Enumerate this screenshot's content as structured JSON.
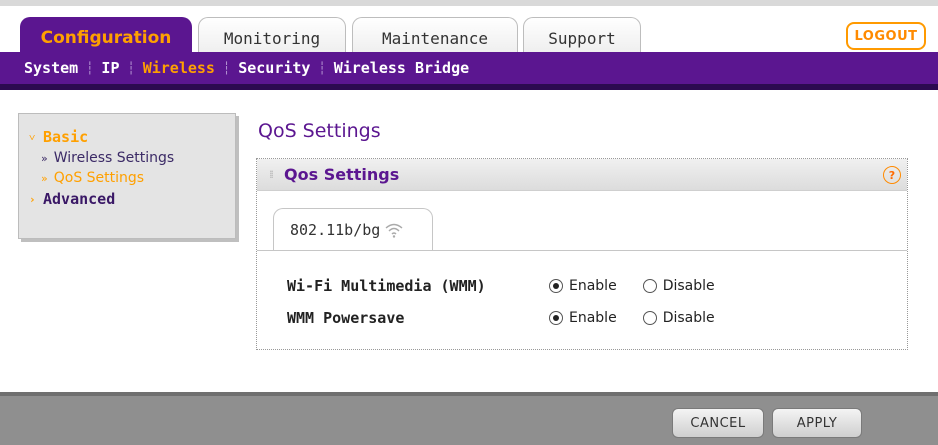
{
  "tabs": [
    {
      "label": "Configuration",
      "active": true
    },
    {
      "label": "Monitoring",
      "active": false
    },
    {
      "label": "Maintenance",
      "active": false
    },
    {
      "label": "Support",
      "active": false
    }
  ],
  "logout_label": "LOGOUT",
  "subnav": [
    {
      "label": "System",
      "active": false
    },
    {
      "label": "IP",
      "active": false
    },
    {
      "label": "Wireless",
      "active": true
    },
    {
      "label": "Security",
      "active": false
    },
    {
      "label": "Wireless Bridge",
      "active": false
    }
  ],
  "leftmenu": {
    "basic_label": "Basic",
    "basic_items": [
      {
        "label": "Wireless Settings",
        "active": false
      },
      {
        "label": "QoS Settings",
        "active": true
      }
    ],
    "advanced_label": "Advanced"
  },
  "page_title": "QoS Settings",
  "section": {
    "title": "Qos Settings",
    "help_label": "?",
    "inner_tab_label": "802.11b/bg",
    "rows": [
      {
        "label": "Wi-Fi Multimedia (WMM)",
        "options": [
          "Enable",
          "Disable"
        ],
        "selected": "Enable"
      },
      {
        "label": "WMM Powersave",
        "options": [
          "Enable",
          "Disable"
        ],
        "selected": "Enable"
      }
    ]
  },
  "buttons": {
    "cancel_label": "CANCEL",
    "apply_label": "APPLY"
  },
  "colors": {
    "brand_purple": "#5b1690",
    "accent_orange": "#ffa000"
  },
  "icons": {
    "wifi": "wifi-signal-icon",
    "help": "help-icon",
    "radio": "radio-button"
  }
}
